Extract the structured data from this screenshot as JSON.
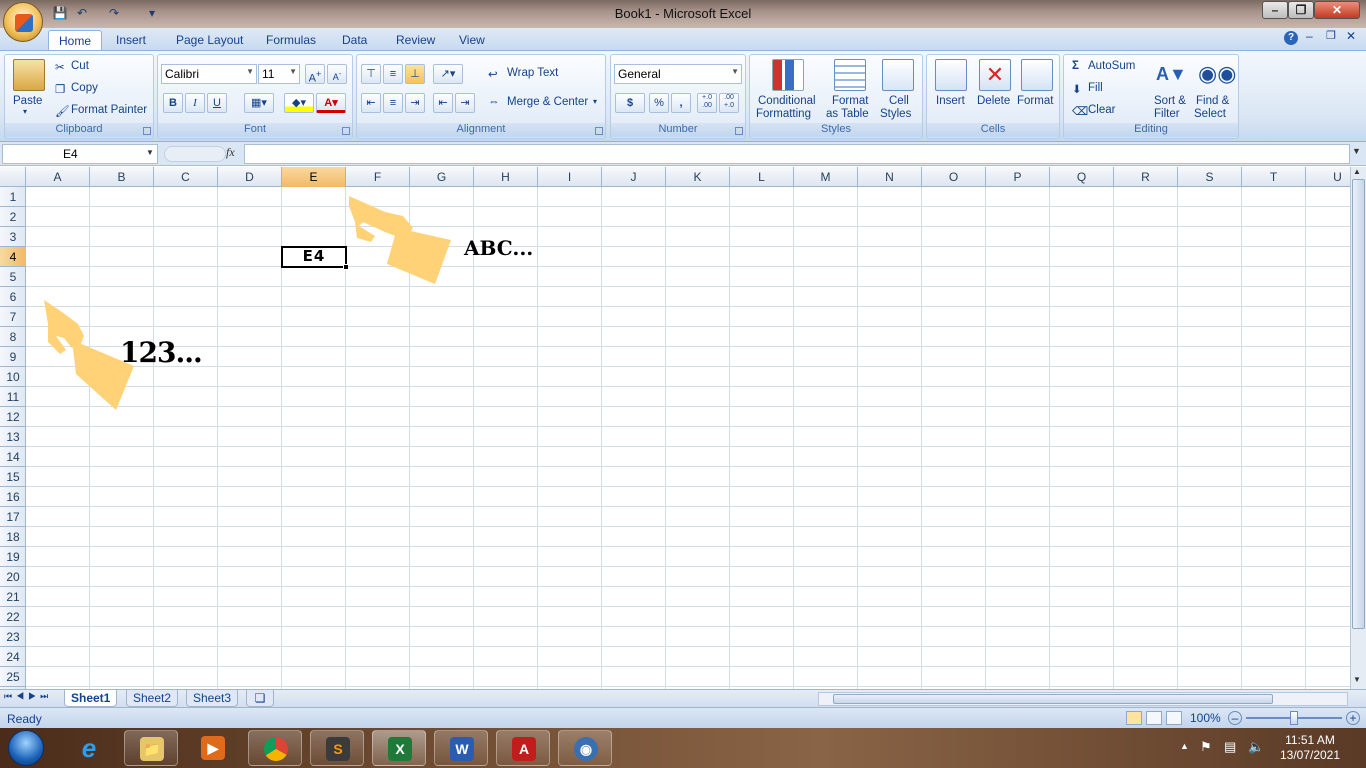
{
  "window": {
    "title": "Book1 - Microsoft Excel"
  },
  "tabs": [
    "Home",
    "Insert",
    "Page Layout",
    "Formulas",
    "Data",
    "Review",
    "View"
  ],
  "ribbon": {
    "clipboard": {
      "paste": "Paste",
      "cut": "Cut",
      "copy": "Copy",
      "format_painter": "Format Painter",
      "label": "Clipboard"
    },
    "font": {
      "family": "Calibri",
      "size": "11",
      "bold": "B",
      "italic": "I",
      "underline": "U",
      "label": "Font"
    },
    "alignment": {
      "wrap_text": "Wrap Text",
      "merge_center": "Merge & Center",
      "label": "Alignment"
    },
    "number": {
      "format": "General",
      "currency": "$",
      "percent": "%",
      "comma": ",",
      "inc_decimal": "+.0 .00",
      "dec_decimal": ".00 +.0",
      "label": "Number"
    },
    "styles": {
      "conditional_1": "Conditional",
      "conditional_2": "Formatting",
      "table_1": "Format",
      "table_2": "as Table",
      "cell_1": "Cell",
      "cell_2": "Styles",
      "label": "Styles"
    },
    "cells": {
      "insert": "Insert",
      "delete": "Delete",
      "format": "Format",
      "label": "Cells"
    },
    "editing": {
      "autosum": "AutoSum",
      "fill": "Fill",
      "clear": "Clear",
      "sort_1": "Sort &",
      "sort_2": "Filter",
      "find_1": "Find &",
      "find_2": "Select",
      "label": "Editing"
    }
  },
  "formula_bar": {
    "name_box": "E4",
    "fx": "fx",
    "value": ""
  },
  "grid": {
    "columns": [
      "A",
      "B",
      "C",
      "D",
      "E",
      "F",
      "G",
      "H",
      "I",
      "J",
      "K",
      "L",
      "M",
      "N",
      "O",
      "P",
      "Q",
      "R",
      "S",
      "T",
      "U"
    ],
    "rows": [
      "1",
      "2",
      "3",
      "4",
      "5",
      "6",
      "7",
      "8",
      "9",
      "10",
      "11",
      "12",
      "13",
      "14",
      "15",
      "16",
      "17",
      "18",
      "19",
      "20",
      "21",
      "22",
      "23",
      "24",
      "25"
    ],
    "selected_column": "E",
    "selected_row": "4",
    "active_cell_text": "E4"
  },
  "annotations": {
    "letters": "ABC...",
    "numbers": "123..."
  },
  "sheets": [
    "Sheet1",
    "Sheet2",
    "Sheet3"
  ],
  "status": {
    "ready": "Ready",
    "zoom": "100%"
  },
  "taskbar": {
    "apps": [
      "start-orb",
      "internet-explorer-icon",
      "file-explorer-icon",
      "media-player-icon",
      "chrome-icon",
      "sublime-icon",
      "excel-icon",
      "word-icon",
      "acrobat-icon",
      "video-editor-icon"
    ],
    "time": "11:51 AM",
    "date": "13/07/2021"
  },
  "colors": {
    "accent": "#15428b",
    "selection": "#f1b967",
    "hand": "#ffd278"
  }
}
